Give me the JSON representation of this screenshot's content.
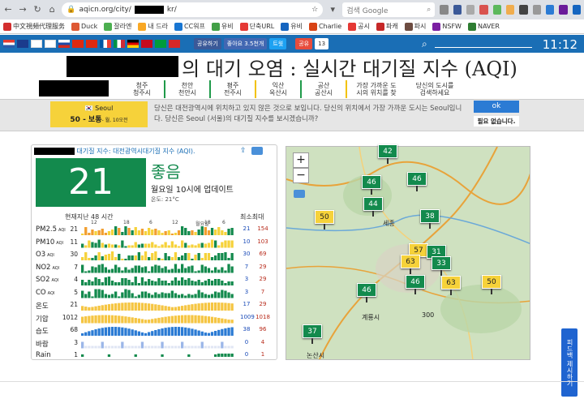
{
  "browser": {
    "url": "aqicn.org/city/",
    "url_suffix": "kr/",
    "search_placeholder": "검색 Google"
  },
  "bookmarks": [
    "中文視頻代理服务",
    "Duck",
    "잘라엔",
    "내 드라",
    "CC워프",
    "유비",
    "단축URL",
    "유비",
    "Charlie",
    "공시",
    "파캐",
    "파시",
    "NSFW",
    "NAVER"
  ],
  "social": {
    "share": "공유하기",
    "like": "좋아요 3.5천개",
    "tweet": "트윗",
    "share2": "공유",
    "count": "13"
  },
  "clock": "11:12",
  "title": "의 대기 오염 : 실시간 대기질 지수 (AQI)",
  "city_tabs": [
    {
      "l1": "청주",
      "l2": "청주시"
    },
    {
      "l1": "천안",
      "l2": "천안시"
    },
    {
      "l1": "평주",
      "l2": "전주시"
    },
    {
      "l1": "익산",
      "l2": "옥산시"
    },
    {
      "l1": "공산",
      "l2": "공산시"
    },
    {
      "l1": "가장 가까운 도",
      "l2": "시의 위치를 찾"
    },
    {
      "l1": "당신의 도시를",
      "l2": "검색하세요"
    }
  ],
  "notice": {
    "seoul_name": "Seoul",
    "seoul_status": "50 - 보통",
    "seoul_time": "- 월, 10오전",
    "text": "당신은 대전광역시에 위치하고 있지 않은 것으로 보입니다. 당신의 위치에서 가장 가까운 도시는 Seoul입니다. 당신은 Seoul (서울)의 대기질 지수를 보시겠습니까?",
    "ok": "ok",
    "no": "필요 없습니다."
  },
  "card": {
    "header": "대기질 지수: 대전광역시대기질 지수 (AQI).",
    "aqi": "21",
    "status": "좋음",
    "updated": "월요일 10시에 업데이트",
    "temp": "온도: 21°C",
    "history_title": "현재지난 48 시간",
    "minmax_title": "최소최대",
    "hour_ticks": [
      "12",
      "18",
      "6",
      "12",
      "18",
      "월요일",
      "6"
    ],
    "rows": [
      {
        "label": "PM2.5",
        "unit": "AQI",
        "cur": "21",
        "min": "21",
        "max": "154"
      },
      {
        "label": "PM10",
        "unit": "AQI",
        "cur": "11",
        "min": "10",
        "max": "103"
      },
      {
        "label": "O3",
        "unit": "AQI",
        "cur": "30",
        "min": "30",
        "max": "69"
      },
      {
        "label": "NO2",
        "unit": "AQI",
        "cur": "7",
        "min": "7",
        "max": "29"
      },
      {
        "label": "SO2",
        "unit": "AQI",
        "cur": "4",
        "min": "3",
        "max": "29"
      },
      {
        "label": "CO",
        "unit": "AQI",
        "cur": "5",
        "min": "3",
        "max": "7"
      },
      {
        "label": "온도",
        "unit": "",
        "cur": "21",
        "min": "17",
        "max": "29"
      },
      {
        "label": "기압",
        "unit": "",
        "cur": "1012",
        "min": "1009",
        "max": "1018"
      },
      {
        "label": "습도",
        "unit": "",
        "cur": "68",
        "min": "38",
        "max": "96"
      },
      {
        "label": "바람",
        "unit": "",
        "cur": "3",
        "min": "0",
        "max": "4"
      },
      {
        "label": "Rain",
        "unit": "",
        "cur": "1",
        "min": "0",
        "max": "1"
      }
    ]
  },
  "map": {
    "markers": [
      {
        "v": "42",
        "c": "g"
      },
      {
        "v": "46",
        "c": "g"
      },
      {
        "v": "46",
        "c": "g"
      },
      {
        "v": "44",
        "c": "g"
      },
      {
        "v": "50",
        "c": "y"
      },
      {
        "v": "38",
        "c": "g"
      },
      {
        "v": "57",
        "c": "y"
      },
      {
        "v": "31",
        "c": "g"
      },
      {
        "v": "63",
        "c": "y"
      },
      {
        "v": "33",
        "c": "g"
      },
      {
        "v": "46",
        "c": "g"
      },
      {
        "v": "46",
        "c": "g"
      },
      {
        "v": "63",
        "c": "y"
      },
      {
        "v": "50",
        "c": "y"
      },
      {
        "v": "37",
        "c": "g"
      }
    ],
    "places": [
      "세종",
      "계룡시",
      "논산시",
      "300"
    ],
    "zoom_in": "+",
    "zoom_out": "−"
  },
  "feedback": "피드백 제시하기"
}
